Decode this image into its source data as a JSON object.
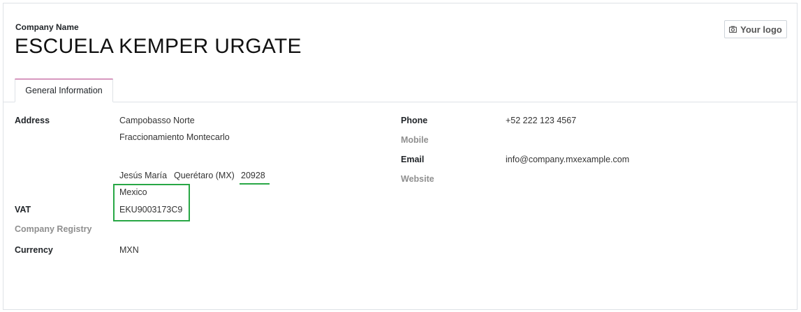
{
  "header": {
    "company_label": "Company Name",
    "company_name": "ESCUELA KEMPER URGATE",
    "logo_button": "Your logo"
  },
  "tabs": [
    {
      "label": "General Information",
      "active": true
    }
  ],
  "address": {
    "label": "Address",
    "street": "Campobasso Norte",
    "street2": "Fraccionamiento Montecarlo",
    "city": "Jesús María",
    "state": "Querétaro (MX)",
    "zip": "20928",
    "country": "Mexico"
  },
  "vat": {
    "label": "VAT",
    "value": "EKU9003173C9"
  },
  "company_registry": {
    "label": "Company Registry",
    "value": ""
  },
  "currency": {
    "label": "Currency",
    "value": "MXN"
  },
  "phone": {
    "label": "Phone",
    "value": "+52 222 123 4567"
  },
  "mobile": {
    "label": "Mobile",
    "value": ""
  },
  "email": {
    "label": "Email",
    "value": "info@company.mxexample.com"
  },
  "website": {
    "label": "Website",
    "value": ""
  },
  "colors": {
    "highlight": "#28a745",
    "tab_accent": "#b43d86"
  }
}
